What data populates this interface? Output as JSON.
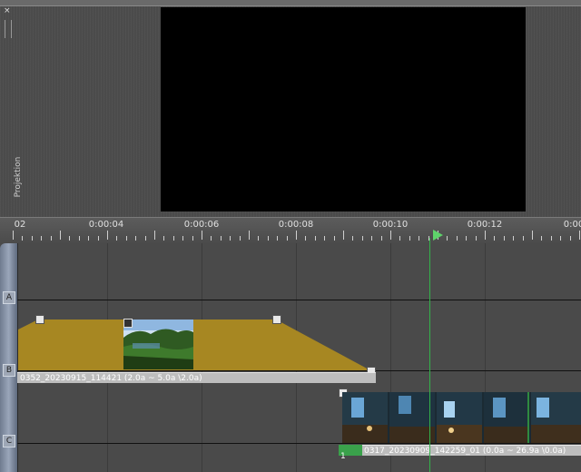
{
  "preview": {
    "close_glyph": "×",
    "side_label": "Projektion"
  },
  "ruler": {
    "labels": [
      "02",
      "0:00:04",
      "0:00:06",
      "0:00:08",
      "0:00:10",
      "0:00:12",
      "0:00"
    ]
  },
  "tracks": [
    {
      "letter": "A"
    },
    {
      "letter": "B"
    },
    {
      "letter": "C"
    }
  ],
  "clips": {
    "b_label": "0352_20230915_114421 (2.0a ~ 5.0a \\2.0a)",
    "c_label": "0317_20230909_142259_01 (0.0a ~ 26.9a \\0.0a)",
    "c_marker": "1"
  },
  "colors": {
    "volume_fill": "#a78722",
    "playhead": "#33b24a"
  }
}
